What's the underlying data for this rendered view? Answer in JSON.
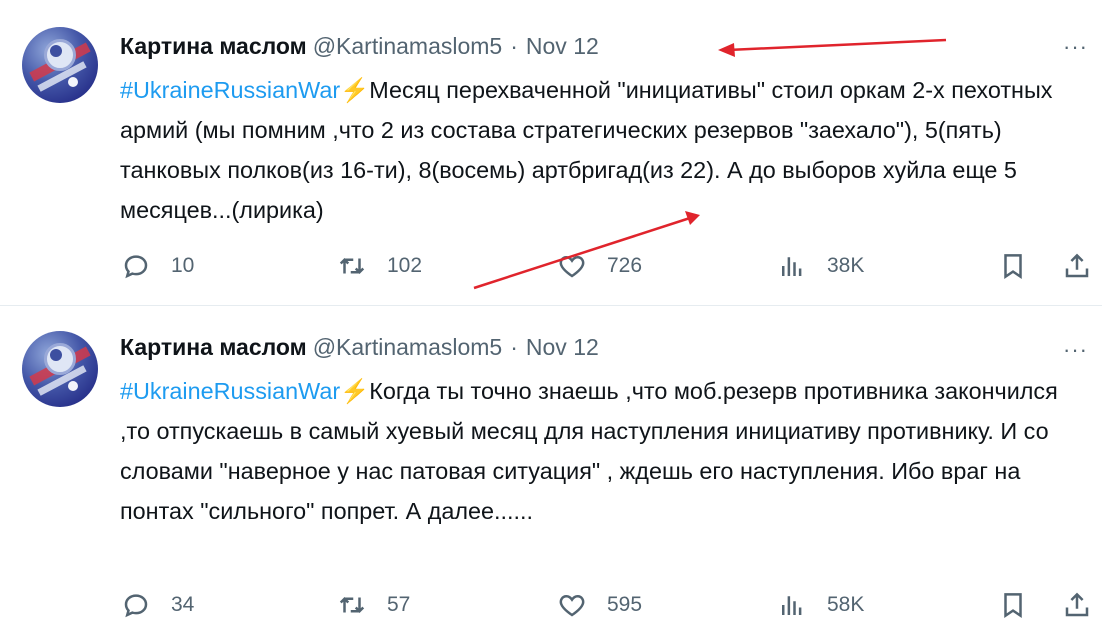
{
  "tweets": [
    {
      "author": "Картина маслом",
      "handle": "@Kartinamaslom5",
      "separator": "·",
      "date": "Nov 12",
      "more": "···",
      "hashtag": "#UkraineRussianWar",
      "bolt": "⚡",
      "text": "Месяц перехваченной \"инициативы\" стоил оркам 2-х пехотных армий (мы помним ,что 2 из состава стратегических резервов \"заехало\"), 5(пять) танковых полков(из 16-ти), 8(восемь) артбригад(из 22).  А до выборов хуйла еще 5 месяцев...(лирика)",
      "stats": {
        "replies": "10",
        "retweets": "102",
        "likes": "726",
        "views": "38K"
      }
    },
    {
      "author": "Картина маслом",
      "handle": "@Kartinamaslom5",
      "separator": "·",
      "date": "Nov 12",
      "more": "···",
      "hashtag": "#UkraineRussianWar",
      "bolt": "⚡",
      "text": "Когда ты точно знаешь ,что моб.резерв противника закончился ,то отпускаешь в самый хуевый месяц для наступления инициативу противнику. И со словами \"наверное у нас патовая ситуация\" , ждешь его наступления. Ибо враг на понтах \"сильного\" попрет. А далее......",
      "stats": {
        "replies": "34",
        "retweets": "57",
        "likes": "595",
        "views": "58K"
      }
    }
  ],
  "icons": {
    "reply": "reply-icon",
    "retweet": "retweet-icon",
    "like": "heart-icon",
    "views": "views-chart-icon",
    "bookmark": "bookmark-icon",
    "share": "share-icon",
    "more": "more-dots-icon"
  },
  "colors": {
    "hashtag": "#1d9bf0",
    "secondary_text": "#536471",
    "annotation_arrow": "#e0242c",
    "bolt": "#f4a70b"
  }
}
